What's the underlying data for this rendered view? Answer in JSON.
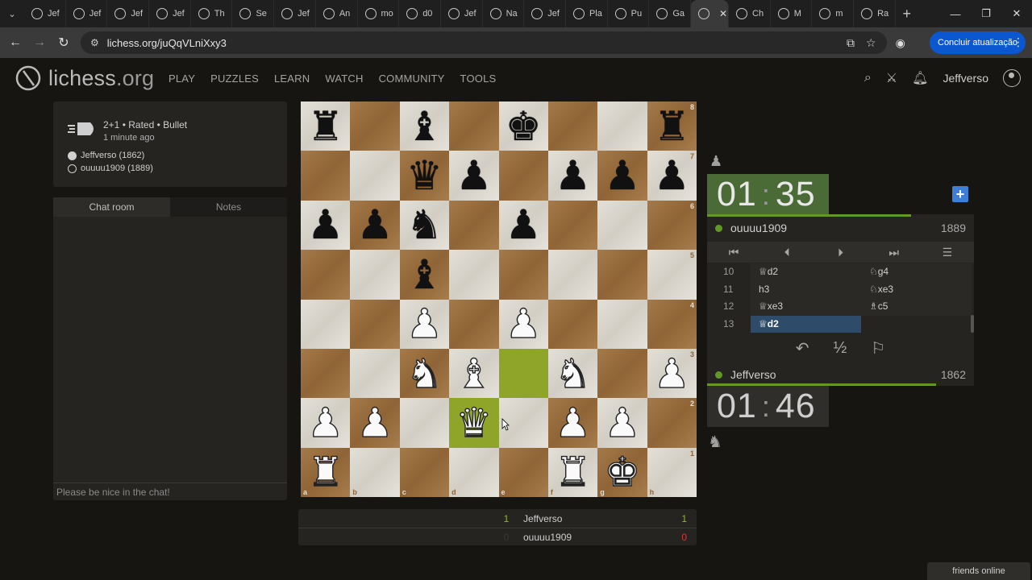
{
  "browser": {
    "tabs": [
      {
        "label": "Jef"
      },
      {
        "label": "Jef"
      },
      {
        "label": "Jef"
      },
      {
        "label": "Jef"
      },
      {
        "label": "Th"
      },
      {
        "label": "Se"
      },
      {
        "label": "Jef"
      },
      {
        "label": "An"
      },
      {
        "label": "mo"
      },
      {
        "label": "d0"
      },
      {
        "label": "Jef"
      },
      {
        "label": "Na"
      },
      {
        "label": "Jef"
      },
      {
        "label": "Pla"
      },
      {
        "label": "Pu"
      },
      {
        "label": "Ga"
      },
      {
        "label": ""
      },
      {
        "label": "Ch"
      },
      {
        "label": "M"
      },
      {
        "label": "m"
      },
      {
        "label": "Ra"
      }
    ],
    "url": "lichess.org/juQqVLniXxy3",
    "update_button": "Concluir atualização"
  },
  "site": {
    "logo_main": "lichess",
    "logo_tld": ".org",
    "nav": [
      "PLAY",
      "PUZZLES",
      "LEARN",
      "WATCH",
      "COMMUNITY",
      "TOOLS"
    ],
    "username": "Jeffverso"
  },
  "game_info": {
    "setup": "2+1 • Rated • Bullet",
    "time_ago": "1 minute ago",
    "white_player": "Jeffverso (1862)",
    "black_player": "ouuuu1909 (1889)"
  },
  "chat": {
    "tab_chat": "Chat room",
    "tab_notes": "Notes",
    "placeholder": "Please be nice in the chat!"
  },
  "board": {
    "ranks": [
      "8",
      "7",
      "6",
      "5",
      "4",
      "3",
      "2",
      "1"
    ],
    "files": [
      "a",
      "b",
      "c",
      "d",
      "e",
      "f",
      "g",
      "h"
    ],
    "position": [
      [
        "br",
        "",
        "bb",
        "",
        "bk",
        "",
        "",
        "br"
      ],
      [
        "",
        "",
        "bq",
        "bp",
        "",
        "bp",
        "bp",
        "bp"
      ],
      [
        "bp",
        "bp",
        "bn",
        "",
        "bp",
        "",
        "",
        ""
      ],
      [
        "",
        "",
        "bb",
        "",
        "",
        "",
        "",
        ""
      ],
      [
        "",
        "",
        "wp",
        "",
        "wp",
        "",
        "",
        ""
      ],
      [
        "",
        "",
        "wn",
        "wb",
        "",
        "wn",
        "",
        "wp"
      ],
      [
        "wp",
        "wp",
        "",
        "wq",
        "",
        "wp",
        "wp",
        ""
      ],
      [
        "wr",
        "",
        "",
        "",
        "",
        "wr",
        "wk",
        ""
      ]
    ],
    "highlights": [
      "d2",
      "e3"
    ]
  },
  "crosstable": {
    "rows": [
      {
        "name": "Jeffverso",
        "left_score": "1",
        "right_score": "1",
        "left_color": "#8fb33a",
        "right_color": "#8fb33a"
      },
      {
        "name": "ouuuu1909",
        "left_score": "0",
        "right_score": "0",
        "left_color": "#3a3835",
        "right_color": "#d23a3a"
      }
    ]
  },
  "clocks": {
    "top": {
      "minutes": "01",
      "seconds": "35"
    },
    "bottom": {
      "minutes": "01",
      "seconds": "46"
    }
  },
  "players": {
    "top": {
      "name": "ouuuu1909",
      "rating": "1889"
    },
    "bottom": {
      "name": "Jeffverso",
      "rating": "1862"
    }
  },
  "moves": [
    {
      "num": "10",
      "white": "♕d2",
      "black": "♘g4"
    },
    {
      "num": "11",
      "white": "h3",
      "black": "♘xe3"
    },
    {
      "num": "12",
      "white": "♕xe3",
      "black": "♗c5"
    },
    {
      "num": "13",
      "white": "♕d2",
      "black": ""
    }
  ],
  "actions": {
    "takeback": "↶",
    "draw": "½",
    "resign": "⚐"
  },
  "friends": "friends online",
  "colors": {
    "accent_green": "#629924",
    "highlight": "#a8bf3a",
    "active_move": "#2f4b6a"
  }
}
